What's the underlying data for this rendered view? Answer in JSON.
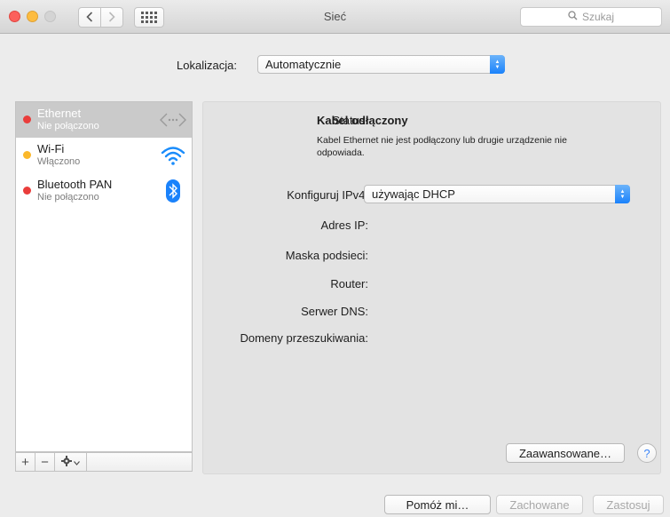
{
  "window": {
    "title": "Sieć",
    "search_placeholder": "Szukaj",
    "back_icon": "chevron-left-icon",
    "forward_icon": "chevron-right-icon",
    "grid_icon": "grid-icon"
  },
  "location": {
    "label": "Lokalizacja:",
    "value": "Automatycznie"
  },
  "sidebar": {
    "items": [
      {
        "name": "Ethernet",
        "status": "Nie połączono",
        "dot": "#ea3d3b",
        "icon": "ethernet-icon",
        "selected": true
      },
      {
        "name": "Wi-Fi",
        "status": "Włączono",
        "dot": "#fbb82a",
        "icon": "wifi-icon",
        "selected": false
      },
      {
        "name": "Bluetooth PAN",
        "status": "Nie połączono",
        "dot": "#ea3d3b",
        "icon": "bluetooth-icon",
        "selected": false
      }
    ],
    "add_label": "+",
    "remove_label": "−"
  },
  "details": {
    "status_label": "Status:",
    "status_value": "Kabel odłączony",
    "status_desc": "Kabel Ethernet nie jest podłączony lub drugie urządzenie nie odpowiada.",
    "ipv4_label": "Konfiguruj IPv4:",
    "ipv4_value": "używając DHCP",
    "ip_label": "Adres IP:",
    "mask_label": "Maska podsieci:",
    "router_label": "Router:",
    "dns_label": "Serwer DNS:",
    "domains_label": "Domeny przeszukiwania:",
    "advanced_label": "Zaawansowane…",
    "help_label": "?"
  },
  "footer": {
    "assist_label": "Pomóż mi…",
    "revert_label": "Zachowane",
    "apply_label": "Zastosuj"
  },
  "colors": {
    "accent": "#1a82fb",
    "selected_row": "#cacaca"
  }
}
